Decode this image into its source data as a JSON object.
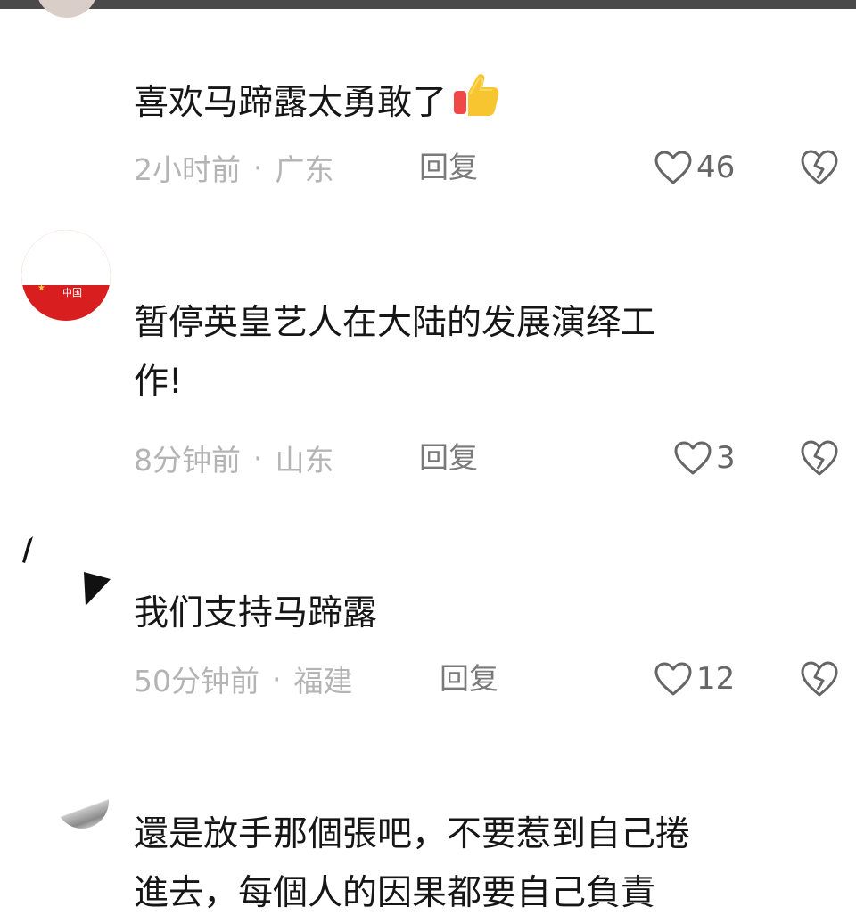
{
  "comments": [
    {
      "text": "喜欢马蹄露太勇敢了",
      "emoji": "thumbs-up-icon",
      "time": "2小时前",
      "separator": "·",
      "location": "广东",
      "reply_label": "回复",
      "likes": "46"
    },
    {
      "text_line1": "暂停英皇艺人在大陆的发展演绎工",
      "text_line2": "作!",
      "avatar_text": "中国",
      "time": "8分钟前",
      "separator": "·",
      "location": "山东",
      "reply_label": "回复",
      "likes": "3"
    },
    {
      "text": "我们支持马蹄露",
      "time": "50分钟前",
      "separator": "·",
      "location": "福建",
      "reply_label": "回复",
      "likes": "12"
    },
    {
      "text_line1": "還是放手那個張吧，不要惹到自己捲",
      "text_line2": "進去，每個人的因果都要自己負責"
    }
  ],
  "colors": {
    "text": "#161616",
    "meta": "#b4b4b4",
    "reply": "#7a7a7a",
    "like": "#666666",
    "avatar_red": "#d81e1e"
  }
}
